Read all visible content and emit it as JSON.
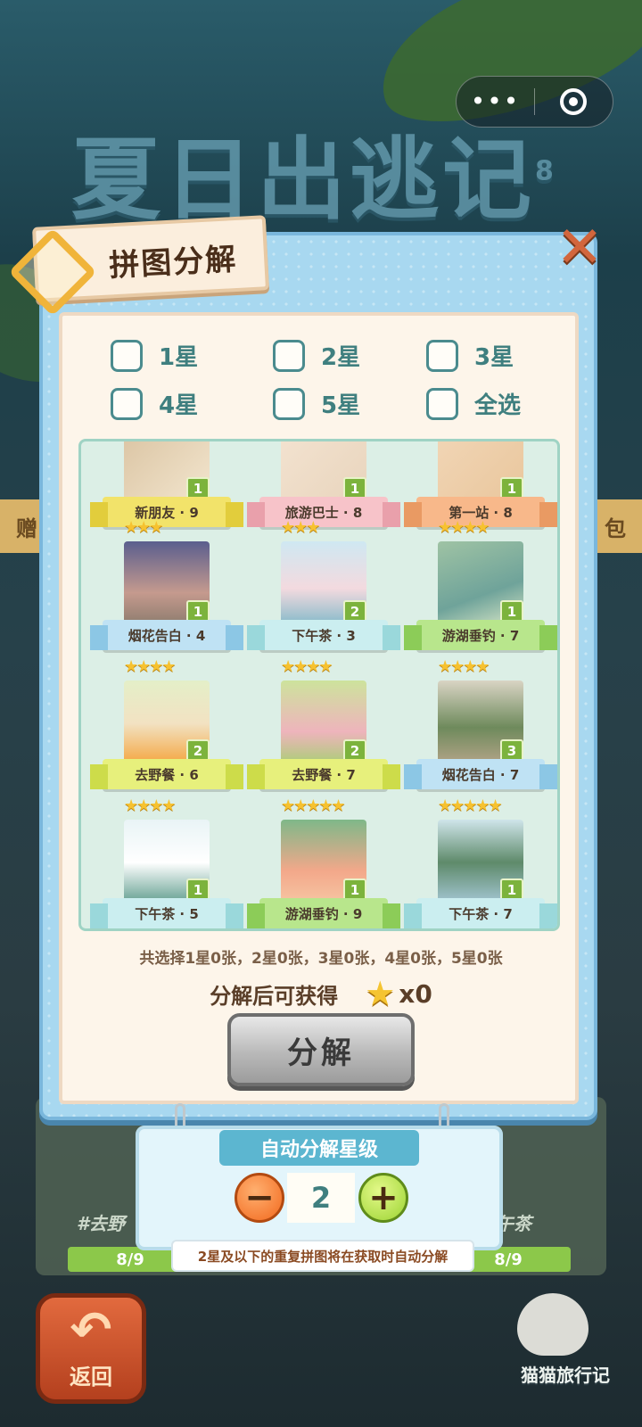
{
  "header": {
    "game_title": "夏日出逃记",
    "title_superscript": "8"
  },
  "background": {
    "left_tab": "赠",
    "right_tab": "包",
    "strip_left": "#去野",
    "strip_right": "午茶",
    "progress_left": "8/9",
    "progress_right": "8/9",
    "back_label": "返回",
    "brand": "猫猫旅行记"
  },
  "modal": {
    "title": "拼图分解",
    "filters": [
      {
        "label": "1星",
        "checked": false
      },
      {
        "label": "2星",
        "checked": false
      },
      {
        "label": "3星",
        "checked": false
      },
      {
        "label": "4星",
        "checked": false
      },
      {
        "label": "5星",
        "checked": false
      },
      {
        "label": "全选",
        "checked": false
      }
    ],
    "cards": [
      {
        "name": "新朋友 · 9",
        "count": "1",
        "stars": "",
        "ribbon": "yellow"
      },
      {
        "name": "旅游巴士 · 8",
        "count": "1",
        "stars": "",
        "ribbon": "pink"
      },
      {
        "name": "第一站 · 8",
        "count": "1",
        "stars": "",
        "ribbon": "orange"
      },
      {
        "name": "烟花告白 · 4",
        "count": "1",
        "stars": "★★★",
        "ribbon": "blue"
      },
      {
        "name": "下午茶 · 3",
        "count": "2",
        "stars": "★★★",
        "ribbon": "cyan"
      },
      {
        "name": "游湖垂钓 · 7",
        "count": "1",
        "stars": "★★★★",
        "ribbon": "green"
      },
      {
        "name": "去野餐 · 6",
        "count": "2",
        "stars": "★★★★",
        "ribbon": "lime"
      },
      {
        "name": "去野餐 · 7",
        "count": "2",
        "stars": "★★★★",
        "ribbon": "lime"
      },
      {
        "name": "烟花告白 · 7",
        "count": "3",
        "stars": "★★★★",
        "ribbon": "blue"
      },
      {
        "name": "下午茶 · 5",
        "count": "1",
        "stars": "★★★★",
        "ribbon": "cyan"
      },
      {
        "name": "游湖垂钓 · 9",
        "count": "1",
        "stars": "★★★★★",
        "ribbon": "green"
      },
      {
        "name": "下午茶 · 7",
        "count": "1",
        "stars": "★★★★★",
        "ribbon": "cyan"
      }
    ],
    "summary": "共选择1星0张，2星0张，3星0张，4星0张，5星0张",
    "reward_label": "分解后可获得",
    "reward_value": "x0",
    "decompose_button": "分解"
  },
  "auto_panel": {
    "title": "自动分解星级",
    "value": "2",
    "hint": "2星及以下的重复拼图将在获取时自动分解"
  },
  "colors": {
    "modal_bg": "#a8d8f0",
    "panel_bg": "#fdf5ea",
    "accent_teal": "#3f7f7f",
    "star": "#f5c431"
  }
}
